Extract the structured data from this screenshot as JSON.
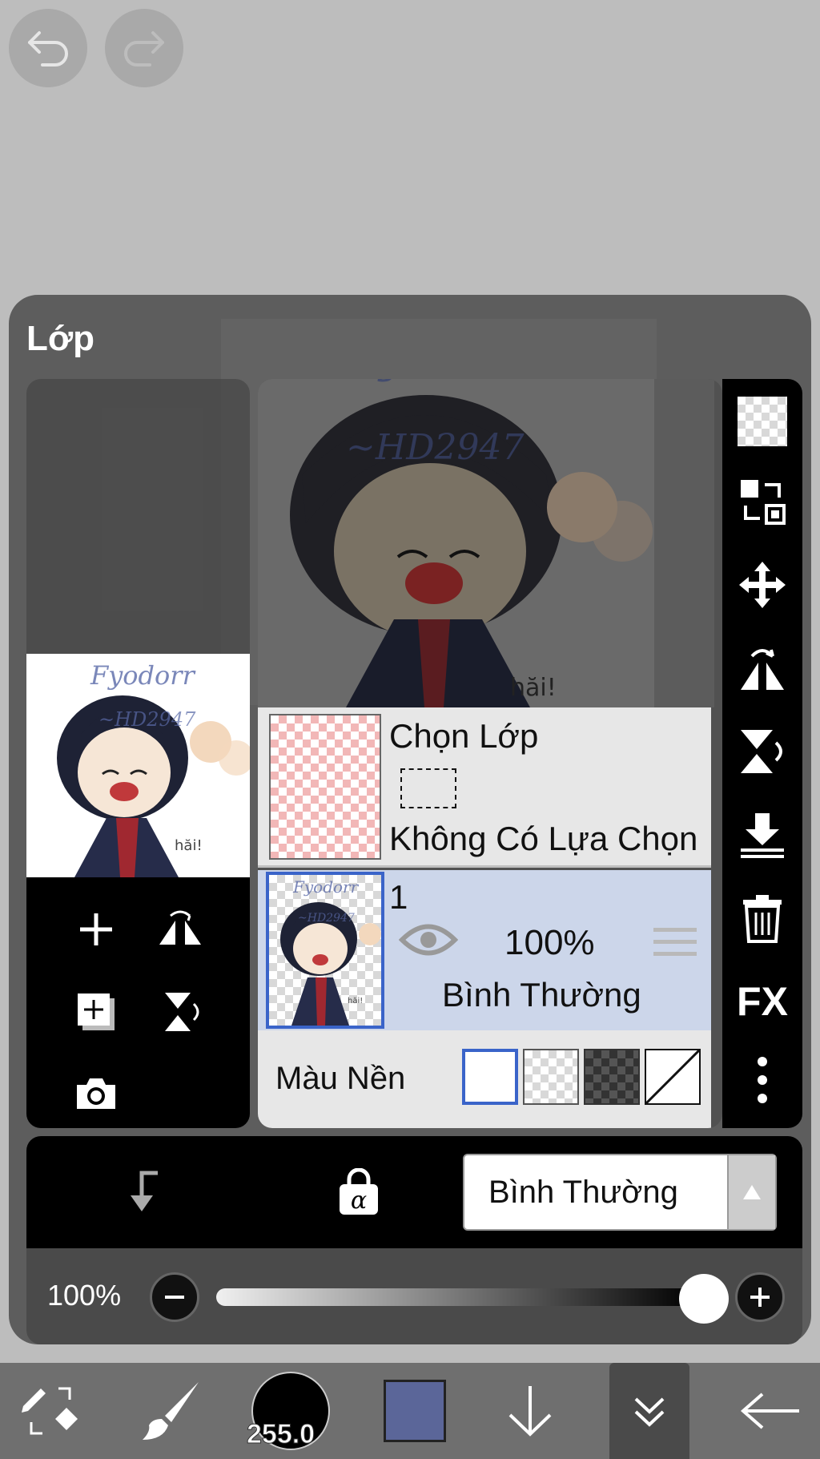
{
  "app": {
    "panel_title": "Lớp"
  },
  "layers": {
    "select_layer_title": "Chọn Lớp",
    "select_layer_status": "Không Có Lựa Chọn",
    "layer_1": {
      "name": "1",
      "opacity": "100%",
      "blend_mode": "Bình Thường"
    },
    "background": {
      "label": "Màu Nền"
    }
  },
  "mode_bar": {
    "blend_mode_value": "Bình Thường"
  },
  "opacity": {
    "value_label": "100%",
    "value": 1.0
  },
  "bottom_bar": {
    "brush_size_value": "255.0",
    "current_color": "#5b6699"
  },
  "artwork": {
    "watermark_top": "Fyodorr",
    "watermark_mid": "~HD2947",
    "signature": "hăi!"
  },
  "side_tools": {
    "fx_label": "FX"
  }
}
